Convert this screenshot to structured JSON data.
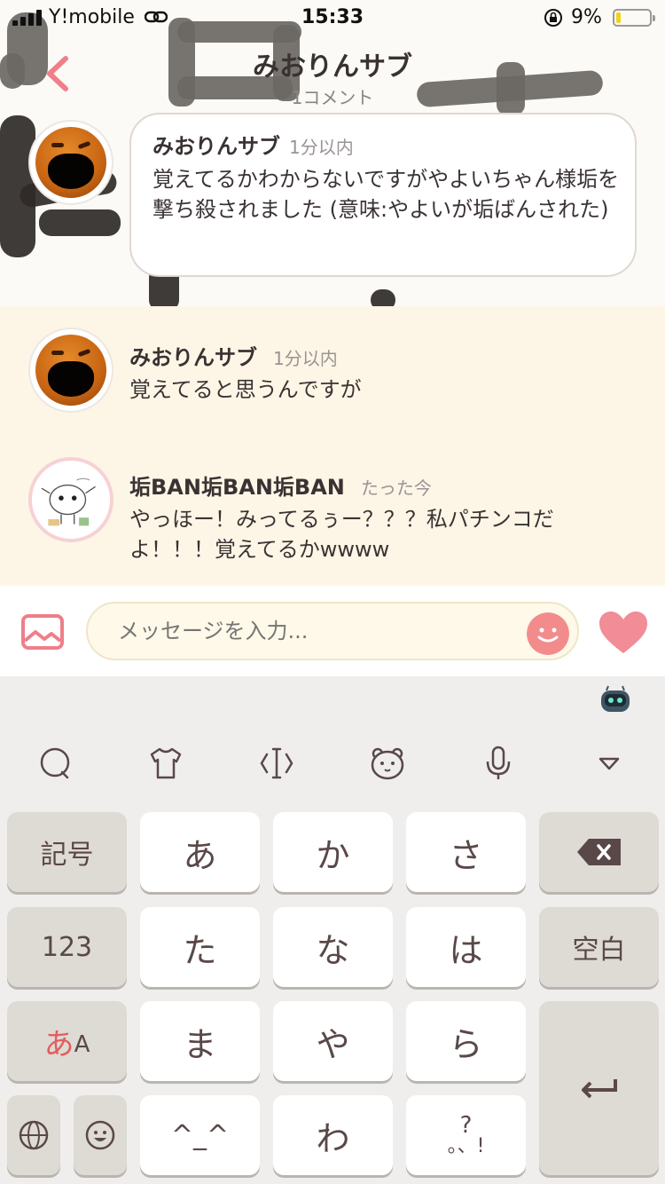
{
  "status_bar": {
    "carrier": "Y!mobile",
    "time": "15:33",
    "battery_percent": "9%",
    "battery_level": 0.09
  },
  "nav": {
    "title": "みおりんサブ",
    "subtitle": "1コメント"
  },
  "post": {
    "author": "みおりんサブ",
    "time": "1分以内",
    "text": "覚えてるかわからないですがやよいちゃん様垢を撃ち殺されました (意味:やよいが垢ばんされた)"
  },
  "comments": [
    {
      "author": "みおりんサブ",
      "time": "1分以内",
      "text": "覚えてると思うんですが",
      "avatar": "orange-avatar"
    },
    {
      "author": "垢BAN垢BAN垢BAN",
      "time": "たった今",
      "text": "やっほー！みってるぅー？？？私パチンコだよ！！！覚えてるかwwww",
      "avatar": "drawing-avatar"
    }
  ],
  "input": {
    "placeholder": "メッセージを入力..."
  },
  "keyboard": {
    "keys": {
      "kigou": "記号",
      "a": "あ",
      "ka": "か",
      "sa": "さ",
      "num": "123",
      "ta": "た",
      "na": "な",
      "ha": "は",
      "space": "空白",
      "a_mode": "あ",
      "a_mode_small": "A",
      "ma": "ま",
      "ya": "や",
      "ra": "ら",
      "face": "^_^",
      "wa": "わ",
      "punct_top": "?",
      "punct_bottom": "。、!"
    }
  },
  "colors": {
    "accent_pink": "#f28c8c",
    "comment_bg": "#fdf6e6",
    "keyboard_bg": "#efeeed"
  }
}
